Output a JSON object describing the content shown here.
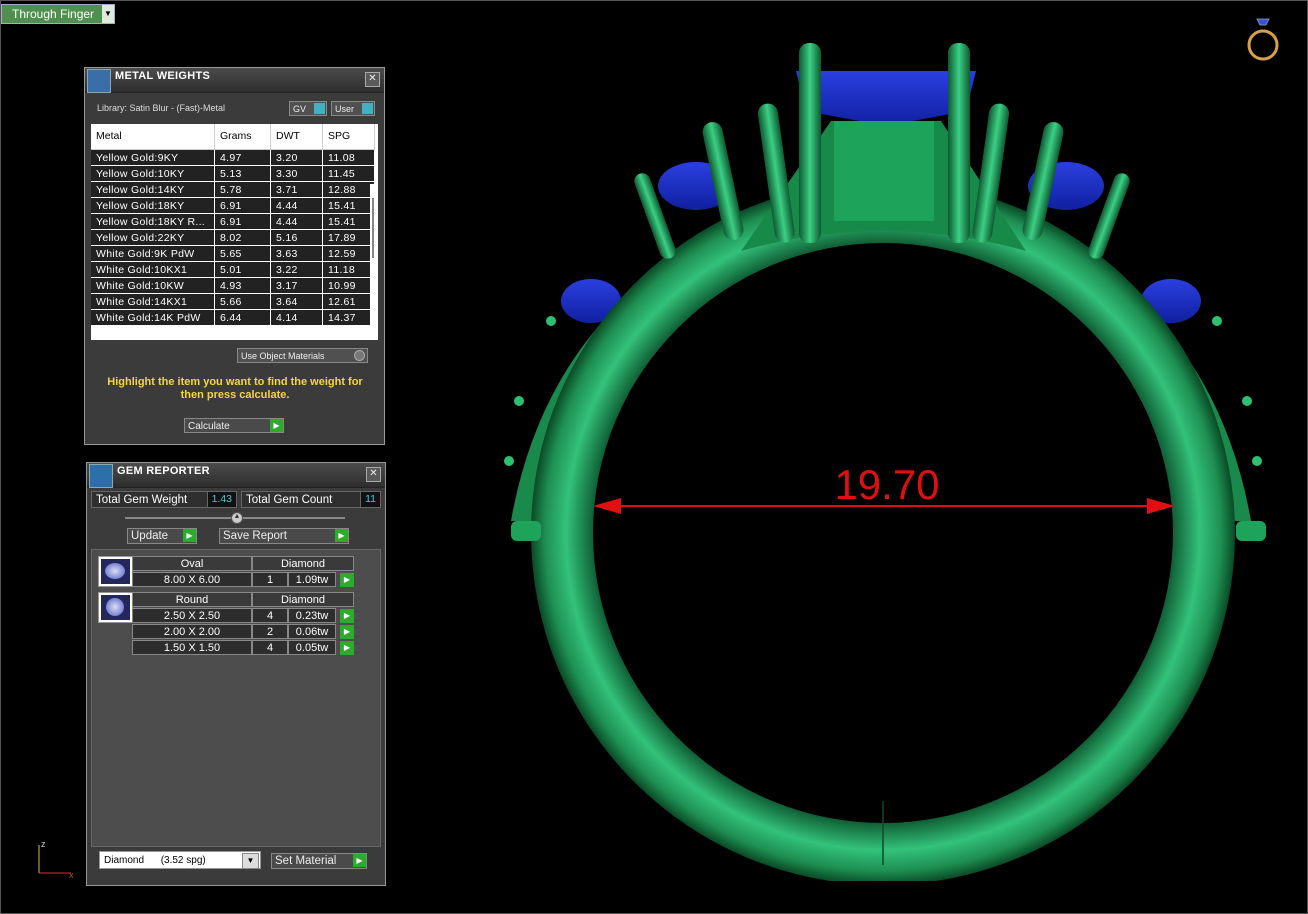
{
  "viewport": {
    "view_name": "Through Finger",
    "measurement": "19.70",
    "axis_z": "z",
    "axis_x": "x"
  },
  "metal_weights": {
    "title": "METAL WEIGHTS",
    "library": "Library: Satin Blur - (Fast)-Metal",
    "gv_label": "GV",
    "user_label": "User",
    "columns": [
      "Metal",
      "Grams",
      "DWT",
      "SPG"
    ],
    "rows": [
      [
        "Yellow Gold:9KY",
        "4.97",
        "3.20",
        "11.08"
      ],
      [
        "Yellow Gold:10KY",
        "5.13",
        "3.30",
        "11.45"
      ],
      [
        "Yellow Gold:14KY",
        "5.78",
        "3.71",
        "12.88"
      ],
      [
        "Yellow Gold:18KY",
        "6.91",
        "4.44",
        "15.41"
      ],
      [
        "Yellow Gold:18KY R...",
        "6.91",
        "4.44",
        "15.41"
      ],
      [
        "Yellow Gold:22KY",
        "8.02",
        "5.16",
        "17.89"
      ],
      [
        "White Gold:9K PdW",
        "5.65",
        "3.63",
        "12.59"
      ],
      [
        "White Gold:10KX1",
        "5.01",
        "3.22",
        "11.18"
      ],
      [
        "White Gold:10KW",
        "4.93",
        "3.17",
        "10.99"
      ],
      [
        "White Gold:14KX1",
        "5.66",
        "3.64",
        "12.61"
      ],
      [
        "White Gold:14K PdW",
        "6.44",
        "4.14",
        "14.37"
      ]
    ],
    "use_object_materials": "Use Object Materials",
    "hint": "Highlight the item you want to find the weight for then press calculate.",
    "calculate": "Calculate"
  },
  "gem_reporter": {
    "title": "GEM REPORTER",
    "total_weight_label": "Total Gem Weight",
    "total_weight": "1.43",
    "total_count_label": "Total Gem Count",
    "total_count": "11",
    "update": "Update",
    "save_report": "Save Report",
    "groups": [
      {
        "shape": "Oval",
        "material": "Diamond",
        "rows": [
          [
            "8.00 X 6.00",
            "1",
            "1.09tw"
          ]
        ]
      },
      {
        "shape": "Round",
        "material": "Diamond",
        "rows": [
          [
            "2.50 X 2.50",
            "4",
            "0.23tw"
          ],
          [
            "2.00 X 2.00",
            "2",
            "0.06tw"
          ],
          [
            "1.50 X 1.50",
            "4",
            "0.05tw"
          ]
        ]
      }
    ],
    "material_select": "Diamond      (3.52 spg)",
    "set_material": "Set Material"
  },
  "colors": {
    "ring_metal": "#1f9a5a",
    "gem_blue": "#2a3fd8",
    "measure_red": "#e01010",
    "hint_yellow": "#f5d63c",
    "accent_green": "#2eaa2e"
  }
}
